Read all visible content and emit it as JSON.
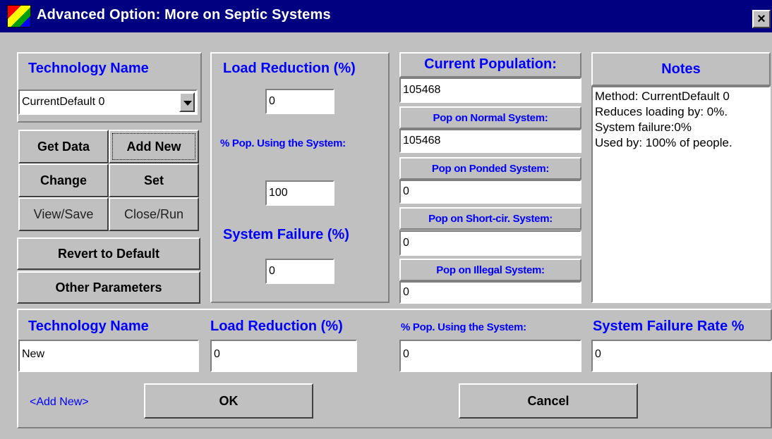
{
  "window": {
    "title": "Advanced Option: More on Septic Systems",
    "close_glyph": "×"
  },
  "left_panel": {
    "technology_name_label": "Technology Name",
    "technology_selected": "CurrentDefault 0",
    "buttons": {
      "get_data": "Get Data",
      "add_new": "Add New",
      "change": "Change",
      "set": "Set",
      "view_save": "View/Save",
      "close_run": "Close/Run",
      "revert": "Revert to Default",
      "other_params": "Other Parameters"
    }
  },
  "middle_panel": {
    "load_reduction_label": "Load Reduction (%)",
    "load_reduction_value": "0",
    "pct_pop_label": "% Pop. Using the System:",
    "pct_pop_value": "100",
    "system_failure_label": "System Failure (%)",
    "system_failure_value": "0"
  },
  "population_panel": {
    "current_population_label": "Current Population:",
    "current_population_value": "105468",
    "normal_label": "Pop on Normal System:",
    "normal_value": "105468",
    "ponded_label": "Pop on Ponded System:",
    "ponded_value": "0",
    "shortcir_label": "Pop on Short-cir. System:",
    "shortcir_value": "0",
    "illegal_label": "Pop on Illegal System:",
    "illegal_value": "0"
  },
  "notes_panel": {
    "label": "Notes",
    "lines": [
      "Method: CurrentDefault 0",
      "Reduces loading by: 0%.",
      "System failure:0%",
      "Used by: 100% of people."
    ]
  },
  "add_new_section": {
    "technology_name_label": "Technology Name",
    "technology_name_value": "New",
    "load_reduction_label": "Load Reduction (%)",
    "load_reduction_value": "0",
    "pct_pop_label": "% Pop. Using the System:",
    "pct_pop_value": "0",
    "failure_rate_label": "System Failure Rate %",
    "failure_rate_value": "0",
    "mode_link": "<Add New>",
    "ok_label": "OK",
    "cancel_label": "Cancel"
  },
  "colors": {
    "titlebar": "#000080",
    "face": "#c0c0c0",
    "label_blue": "#0000ff"
  }
}
